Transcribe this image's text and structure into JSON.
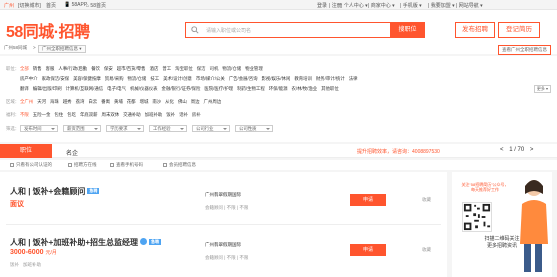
{
  "topbar": {
    "city": "广州",
    "switch": "[切换城市]",
    "home": "首页",
    "app": "58APP",
    "site": "58首页",
    "login": "登录",
    "register": "注册",
    "personal": "个人中心",
    "merchant": "商家中心",
    "mobile": "手机版",
    "enterprise": "我要加盟",
    "navigation": "网站导航"
  },
  "header": {
    "logo_num": "58",
    "logo_text": "同城·招聘",
    "search_placeholder": "请输入职位或公司名",
    "search_button": "搜职位",
    "post_button": "发布招聘",
    "resume_button": "登记简历"
  },
  "breadcrumb": {
    "items": [
      "广州58同城",
      ">",
      "广州全职招聘信息",
      "▾"
    ],
    "right_link": "查看广州全职招聘信息"
  },
  "filters": {
    "job_label": "职位：",
    "job_rows": [
      [
        "全部",
        "销售",
        "客服",
        "人事/行政/后勤",
        "餐饮",
        "保安",
        "超市/百货/零售",
        "酒店",
        "普工",
        "淘宝职位",
        "保洁",
        "司机",
        "物流/仓储",
        "物业管理"
      ],
      [
        "房产中介",
        "家政保洁/安保",
        "美容/保健按摩",
        "贸易/采购",
        "物流/仓储",
        "技工",
        "美术/设计/创意",
        "市场/媒介/公关",
        "广告/会展/咨询",
        "影视/娱乐/休闲",
        "教育培训",
        "财务/审计/统计",
        "法律"
      ],
      [
        "翻译",
        "编辑/出版/印刷",
        "计算机/互联网/通信",
        "电子/电气",
        "机械/仪器仪表",
        "金融/银行/证券/保险",
        "医院/医疗/护理",
        "制药/生物工程",
        "环保/能源",
        "农/林/牧/渔业",
        "其他职位"
      ]
    ],
    "more": "更多",
    "area_label": "区域：",
    "areas": [
      "全广州",
      "天河",
      "海珠",
      "越秀",
      "荔湾",
      "白云",
      "番禺",
      "黄埔",
      "花都",
      "增城",
      "南沙",
      "从化",
      "佛山",
      "周边",
      "广州周边"
    ],
    "welfare_label": "福利：",
    "welfare": [
      "不限",
      "五险一金",
      "包住",
      "包吃",
      "年底双薪",
      "周末双休",
      "交通补助",
      "加班补助",
      "饭补",
      "话补",
      "房补"
    ],
    "filter_label": "筛选：",
    "selects": [
      "发布时间",
      "薪资范围",
      "学历要求",
      "工作经验",
      "公司行业",
      "公司性质"
    ]
  },
  "tabs": {
    "jobs": "职位",
    "companies": "名企",
    "info": "提升招聘效率，请咨询：4008897530",
    "page_current": "1",
    "page_total": "/ 70",
    "prev": "<",
    "next": ">"
  },
  "options": [
    "只看有公司认证的",
    "招聘方在线",
    "查看手机号码",
    "会员招聘信息"
  ],
  "jobs": [
    {
      "title": "人和 | 饭补+会籍顾问",
      "badge": "急聘",
      "salary": "面议",
      "salary_unit": "",
      "welfare": [],
      "company": "广州翡翠假期国际",
      "company_tags": [
        "会籍顾问",
        "不限",
        "不限"
      ],
      "apply": "申请",
      "fav": "收藏"
    },
    {
      "title": "人和 | 饭补+加班补助+招生总监经理",
      "badge": "急聘",
      "salary": "3000-6000",
      "salary_unit": "元/月",
      "welfare": [
        "饭补",
        "加班补助"
      ],
      "company": "广州翡翠假期国际",
      "company_tags": [
        "会籍顾问",
        "不限",
        "不限"
      ],
      "apply": "申请",
      "fav": "收藏"
    }
  ],
  "side": {
    "promo": "关注“58招聘简历”公众号，每天推荐好工作",
    "caption1": "扫描二维码关注",
    "caption2": "更多招聘资讯"
  },
  "colors": {
    "accent": "#ff552e",
    "badge": "#4ea4f2"
  }
}
